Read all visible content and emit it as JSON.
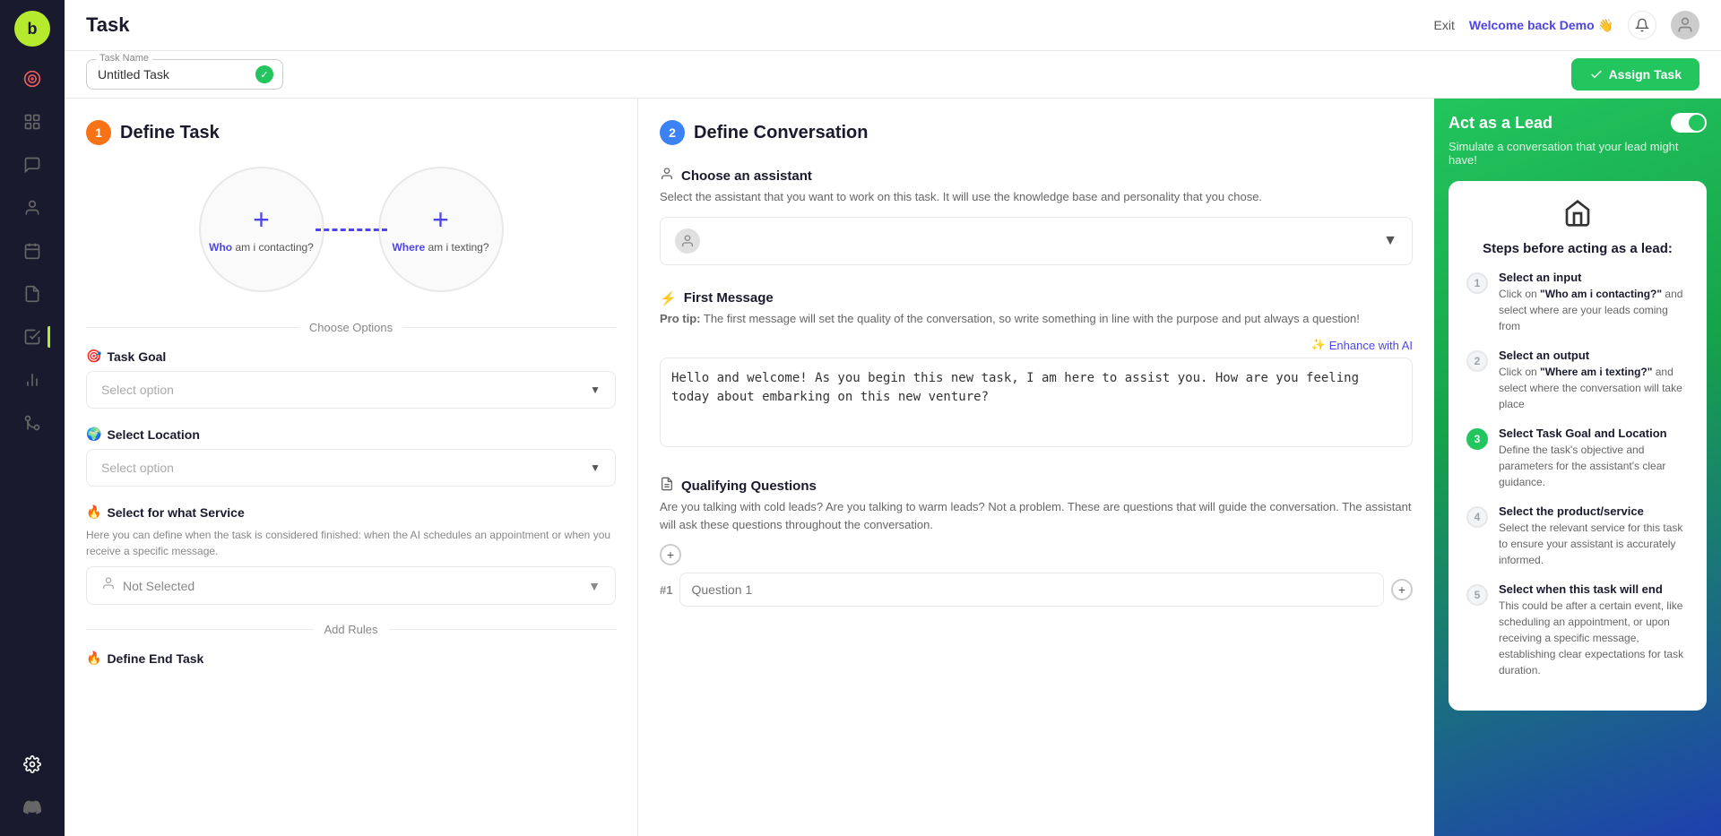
{
  "app": {
    "logo": "b",
    "title": "Task"
  },
  "sidebar": {
    "items": [
      {
        "id": "logo",
        "icon": "b",
        "label": "Logo"
      },
      {
        "id": "target",
        "icon": "⊕",
        "label": "Target"
      },
      {
        "id": "dashboard",
        "icon": "⊞",
        "label": "Dashboard"
      },
      {
        "id": "chat",
        "icon": "💬",
        "label": "Chat"
      },
      {
        "id": "contacts",
        "icon": "👤",
        "label": "Contacts"
      },
      {
        "id": "calendar",
        "icon": "📅",
        "label": "Calendar"
      },
      {
        "id": "reports",
        "icon": "📊",
        "label": "Reports"
      },
      {
        "id": "tasks",
        "icon": "📋",
        "label": "Tasks"
      },
      {
        "id": "analytics",
        "icon": "⚡",
        "label": "Analytics"
      },
      {
        "id": "settings",
        "icon": "⚙️",
        "label": "Settings"
      },
      {
        "id": "integrations",
        "icon": "🔧",
        "label": "Integrations"
      }
    ]
  },
  "topbar": {
    "title": "Task",
    "exit_label": "Exit",
    "welcome_text": "Welcome back",
    "user_name": "Demo",
    "user_emoji": "👋"
  },
  "task_name_bar": {
    "task_name_label": "Task Name",
    "task_name_value": "Untitled Task",
    "assign_button": "Assign Task"
  },
  "define_task": {
    "step_number": "1",
    "title": "Define Task",
    "contact_label_who": "Who am i contacting?",
    "contact_label_where": "Where am i texting?",
    "contact_who_keyword": "Who",
    "contact_where_keyword": "Where",
    "choose_options_label": "Choose Options",
    "task_goal": {
      "title": "Task Goal",
      "placeholder": "Select option"
    },
    "select_location": {
      "title": "Select Location",
      "placeholder": "Select option"
    },
    "select_service": {
      "title": "Select for what Service",
      "description": "Here you can define when the task is considered finished: when the AI schedules an appointment or when you receive a specific message.",
      "placeholder": "Not Selected"
    },
    "add_rules_label": "Add Rules",
    "define_end_task_label": "Define End Task"
  },
  "define_conversation": {
    "step_number": "2",
    "title": "Define Conversation",
    "choose_assistant": {
      "title": "Choose an assistant",
      "description": "Select the assistant that you want to work on this task. It will use the knowledge base and personality that you chose."
    },
    "first_message": {
      "title": "First Message",
      "pro_tip_label": "Pro tip:",
      "pro_tip_text": "The first message will set the quality of the conversation, so write something in line with the purpose and put always a question!",
      "enhance_label": "Enhance with AI",
      "message_value": "Hello and welcome! As you begin this new task, I am here to assist you. How are you feeling today about embarking on this new venture?"
    },
    "qualifying_questions": {
      "title": "Qualifying Questions",
      "description": "Are you talking with cold leads? Are you talking to warm leads? Not a problem. These are questions that will guide the conversation. The assistant will ask these questions throughout the conversation.",
      "question1_placeholder": "Question 1"
    }
  },
  "lead_sidebar": {
    "title": "Act as a Lead",
    "subtitle": "Simulate a conversation that your lead might have!",
    "toggle_state": "on",
    "card_icon": "🏠",
    "steps_title": "Steps before acting as a lead:",
    "steps": [
      {
        "number": "1",
        "state": "inactive",
        "title": "Select an input",
        "description": "Click on \"Who am i contacting?\" and select where are your leads coming from"
      },
      {
        "number": "2",
        "state": "inactive",
        "title": "Select an output",
        "description": "Click on \"Where am i texting?\" and select where the conversation will take place"
      },
      {
        "number": "3",
        "state": "active",
        "title": "Select Task Goal and Location",
        "description": "Define the task's objective and parameters for the assistant's clear guidance."
      },
      {
        "number": "4",
        "state": "inactive",
        "title": "Select the product/service",
        "description": "Select the relevant service for this task to ensure your assistant is accurately informed."
      },
      {
        "number": "5",
        "state": "inactive",
        "title": "Select when this task will end",
        "description": "This could be after a certain event, like scheduling an appointment, or upon receiving a specific message, establishing clear expectations for task duration."
      }
    ]
  }
}
